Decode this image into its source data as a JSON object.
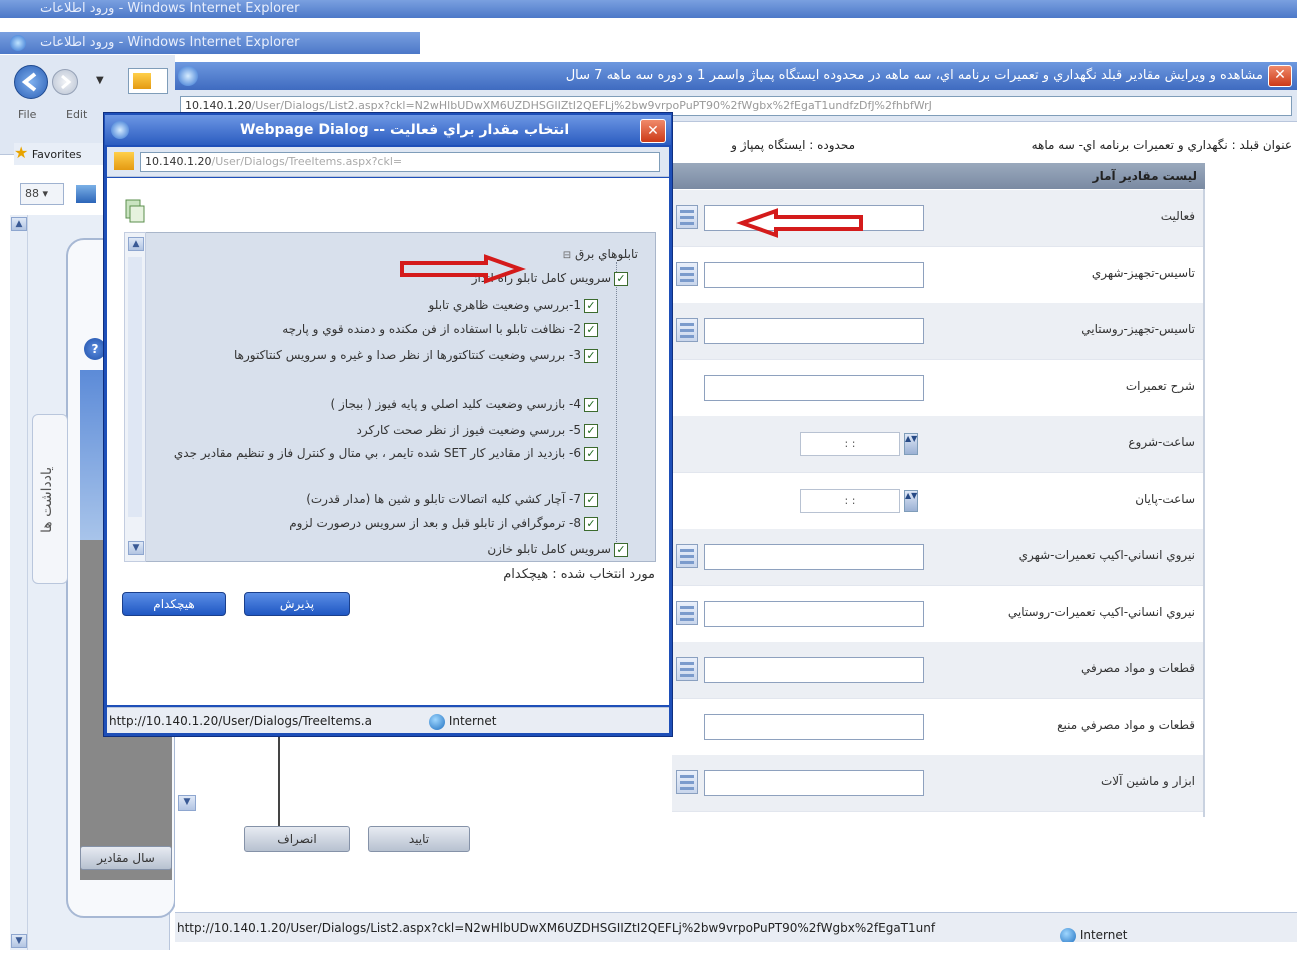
{
  "background_window": {
    "title_1": "ورود اطلاعات - Windows Internet Explorer",
    "title_2": "ورود اطلاعات - Windows Internet Explorer",
    "menu_file": "File",
    "menu_edit": "Edit",
    "favorites": "Favorites",
    "vertical_tab": "يادداشت ها",
    "left_button": "سال مقادير"
  },
  "main_window": {
    "title": "مشاهده و ويرايش مقادير قبلد نگهداري و تعميرات برنامه اي، سه ماهه در محدوده ايستگاه پمپاژ واسمر 1 و دوره سه ماهه 7 سال",
    "address_host": "10.140.1.20",
    "address_rest": "/User/Dialogs/List2.aspx?ckl=N2wHlbUDwXM6UZDHSGIIZtI2QEFLj%2bw9vrpoPuPT90%2fWgbx%2fEgaT1undfzDfJ%2fhbfWrJ",
    "info_right": "عنوان قبلد : نگهداري و تعميرات برنامه اي- سه ماهه",
    "info_left": "محدوده : ايستگاه پمپاژ و",
    "header": "ليست مقادير آمار",
    "rows": [
      {
        "label": "فعاليت",
        "type": "lookup"
      },
      {
        "label": "تاسيس-تجهيز-شهري",
        "type": "lookup"
      },
      {
        "label": "تاسيس-تجهيز-روستايي",
        "type": "lookup"
      },
      {
        "label": "شرح تعميرات",
        "type": "text"
      },
      {
        "label": "ساعت-شروع",
        "type": "time",
        "value": ": :"
      },
      {
        "label": "ساعت-پايان",
        "type": "time",
        "value": ": :"
      },
      {
        "label": "نيروي انساني-اكيپ تعميرات-شهري",
        "type": "lookup"
      },
      {
        "label": "نيروي انساني-اكيپ تعميرات-روستايي",
        "type": "lookup"
      },
      {
        "label": "قطعات و مواد مصرفي",
        "type": "lookup"
      },
      {
        "label": "قطعات و مواد مصرفي منبع",
        "type": "text"
      },
      {
        "label": "ابزار و ماشين آلات",
        "type": "lookup"
      }
    ],
    "btn_confirm": "تاييد",
    "btn_cancel": "انصراف",
    "status_url": "http://10.140.1.20/User/Dialogs/List2.aspx?ckl=N2wHlbUDwXM6UZDHSGIIZtI2QEFLj%2bw9vrpoPuPT90%2fWgbx%2fEgaT1unf",
    "status_zone": "Internet"
  },
  "dialog": {
    "title": "انتخاب مقدار براي فعاليت -- Webpage Dialog",
    "address_host": "10.140.1.20",
    "address_rest": "/User/Dialogs/TreeItems.aspx?ckl=",
    "tree_top": "تابلوهاي برق",
    "tree_items": [
      {
        "text": "سرويس كامل تابلو راه انداز",
        "checked": true
      },
      {
        "text": "1-بررسي وضعيت ظاهري تابلو",
        "checked": true
      },
      {
        "text": "2- نظافت تابلو با استفاده از فن مكنده و دمنده قوي و پارچه",
        "checked": true
      },
      {
        "text": "3- بررسي وضعيت كنتاكتورها از نظر صدا و غيره و سرويس كنتاكتورها",
        "checked": true
      },
      {
        "text": "4- بازرسي وضعيت كليد اصلي و پايه فيوز ( بيجاز )",
        "checked": true
      },
      {
        "text": "5- بررسي وضعيت فيوز از نظر صحت كاركرد",
        "checked": true
      },
      {
        "text": "6- بازديد از مقادير كار SET شده تايمر ، بي متال و كنترل فاز و تنظيم مقادير جدي",
        "checked": true
      },
      {
        "text": "7- آچار كشي كليه اتصالات تابلو و شين ها (مدار قدرت)",
        "checked": true
      },
      {
        "text": "8- ترموگرافي از تابلو قبل و بعد از سرويس درصورت لزوم",
        "checked": true
      },
      {
        "text": "سرويس كامل تابلو خازن",
        "checked": true
      }
    ],
    "selected_label": "مورد انتخاب شده : هيچكدام",
    "btn_none": "هيچكدام",
    "btn_accept": "پذيرش",
    "status_url": "http://10.140.1.20/User/Dialogs/TreeItems.a",
    "status_zone": "Internet"
  },
  "colors": {
    "annotation_arrow": "#d41b1b",
    "dialog_frame": "#1e4fb8",
    "title_blue": "#4c78c8"
  }
}
